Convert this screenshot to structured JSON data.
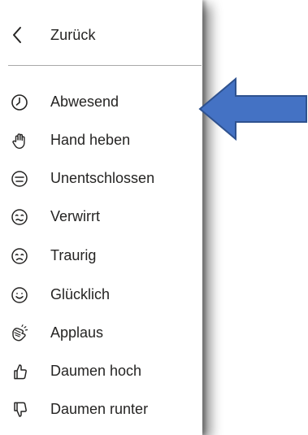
{
  "menu": {
    "back_label": "Zurück",
    "items": [
      {
        "label": "Abwesend",
        "icon": "clock-icon"
      },
      {
        "label": "Hand heben",
        "icon": "raised-hand-icon"
      },
      {
        "label": "Unentschlossen",
        "icon": "neutral-face-icon"
      },
      {
        "label": "Verwirrt",
        "icon": "confused-face-icon"
      },
      {
        "label": "Traurig",
        "icon": "sad-face-icon"
      },
      {
        "label": "Glücklich",
        "icon": "happy-face-icon"
      },
      {
        "label": "Applaus",
        "icon": "clapping-hands-icon"
      },
      {
        "label": "Daumen hoch",
        "icon": "thumbs-up-icon"
      },
      {
        "label": "Daumen runter",
        "icon": "thumbs-down-icon"
      }
    ]
  },
  "colors": {
    "text": "#252423",
    "arrow_fill": "#4472c4",
    "arrow_stroke": "#2f528f",
    "divider": "#a9a9a9"
  }
}
